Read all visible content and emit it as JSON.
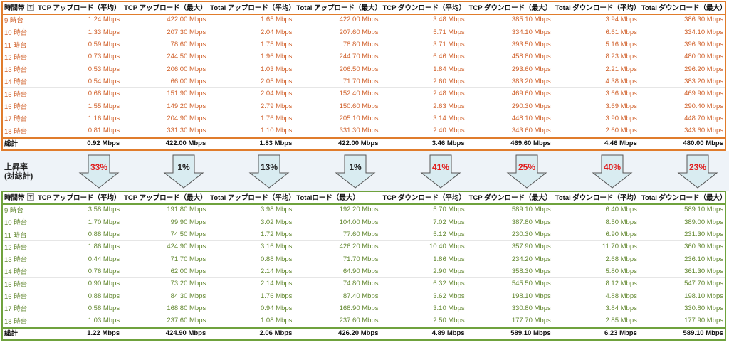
{
  "top_table": {
    "headers": [
      "時間帯",
      "TCP アップロード（平均）",
      "TCP アップロード（最大）",
      "Total アップロード（平均）",
      "Total アップロード（最大）",
      "TCP ダウンロード（平均）",
      "TCP ダウンロード（最大）",
      "Total ダウンロード（平均）",
      "Total ダウンロード（最大）"
    ],
    "rows": [
      [
        "9 時台",
        "1.24 Mbps",
        "422.00 Mbps",
        "1.65 Mbps",
        "422.00 Mbps",
        "3.48 Mbps",
        "385.10 Mbps",
        "3.94 Mbps",
        "386.30 Mbps"
      ],
      [
        "10 時台",
        "1.33 Mbps",
        "207.30 Mbps",
        "2.04 Mbps",
        "207.60 Mbps",
        "5.71 Mbps",
        "334.10 Mbps",
        "6.61 Mbps",
        "334.10 Mbps"
      ],
      [
        "11 時台",
        "0.59 Mbps",
        "78.60 Mbps",
        "1.75 Mbps",
        "78.80 Mbps",
        "3.71 Mbps",
        "393.50 Mbps",
        "5.16 Mbps",
        "396.30 Mbps"
      ],
      [
        "12 時台",
        "0.73 Mbps",
        "244.50 Mbps",
        "1.96 Mbps",
        "244.70 Mbps",
        "6.46 Mbps",
        "458.80 Mbps",
        "8.23 Mbps",
        "480.00 Mbps"
      ],
      [
        "13 時台",
        "0.53 Mbps",
        "206.00 Mbps",
        "1.03 Mbps",
        "206.50 Mbps",
        "1.84 Mbps",
        "293.60 Mbps",
        "2.21 Mbps",
        "296.20 Mbps"
      ],
      [
        "14 時台",
        "0.54 Mbps",
        "66.00 Mbps",
        "2.05 Mbps",
        "71.70 Mbps",
        "2.60 Mbps",
        "383.20 Mbps",
        "4.38 Mbps",
        "383.20 Mbps"
      ],
      [
        "15 時台",
        "0.68 Mbps",
        "151.90 Mbps",
        "2.04 Mbps",
        "152.40 Mbps",
        "2.48 Mbps",
        "469.60 Mbps",
        "3.66 Mbps",
        "469.90 Mbps"
      ],
      [
        "16 時台",
        "1.55 Mbps",
        "149.20 Mbps",
        "2.79 Mbps",
        "150.60 Mbps",
        "2.63 Mbps",
        "290.30 Mbps",
        "3.69 Mbps",
        "290.40 Mbps"
      ],
      [
        "17 時台",
        "1.16 Mbps",
        "204.90 Mbps",
        "1.76 Mbps",
        "205.10 Mbps",
        "3.14 Mbps",
        "448.10 Mbps",
        "3.90 Mbps",
        "448.70 Mbps"
      ],
      [
        "18 時台",
        "0.81 Mbps",
        "331.30 Mbps",
        "1.10 Mbps",
        "331.30 Mbps",
        "2.40 Mbps",
        "343.60 Mbps",
        "2.60 Mbps",
        "343.60 Mbps"
      ]
    ],
    "total": [
      "総計",
      "0.92 Mbps",
      "422.00 Mbps",
      "1.83 Mbps",
      "422.00 Mbps",
      "3.46 Mbps",
      "469.60 Mbps",
      "4.46 Mbps",
      "480.00 Mbps"
    ]
  },
  "rise": {
    "label_line1": "上昇率",
    "label_line2": "(対総計)",
    "arrows": [
      {
        "text": "33%",
        "color": "red"
      },
      {
        "text": "1%",
        "color": "black"
      },
      {
        "text": "13%",
        "color": "black"
      },
      {
        "text": "1%",
        "color": "black"
      },
      {
        "text": "41%",
        "color": "red"
      },
      {
        "text": "25%",
        "color": "red"
      },
      {
        "text": "40%",
        "color": "red"
      },
      {
        "text": "23%",
        "color": "red"
      }
    ],
    "arrow_fill": "#d9ecf1",
    "arrow_stroke": "#555555"
  },
  "bottom_table": {
    "headers": [
      "時間帯",
      "TCP アップロード（平均）",
      "TCP アップロード（最大）",
      "Total アップロード（平均）",
      "Totalロード（最大）",
      "TCP ダウンロード（平均）",
      "TCP ダウンロード（最大）",
      "Total ダウンロード（平均）",
      "Total ダウンロード（最大）"
    ],
    "rows": [
      [
        "9 時台",
        "3.58 Mbps",
        "191.80 Mbps",
        "3.98 Mbps",
        "192.20 Mbps",
        "5.70 Mbps",
        "589.10 Mbps",
        "6.40 Mbps",
        "589.10 Mbps"
      ],
      [
        "10 時台",
        "1.70 Mbps",
        "99.90 Mbps",
        "3.02 Mbps",
        "104.00 Mbps",
        "7.02 Mbps",
        "387.80 Mbps",
        "8.50 Mbps",
        "389.00 Mbps"
      ],
      [
        "11 時台",
        "0.88 Mbps",
        "74.50 Mbps",
        "1.72 Mbps",
        "77.60 Mbps",
        "5.12 Mbps",
        "230.30 Mbps",
        "6.90 Mbps",
        "231.30 Mbps"
      ],
      [
        "12 時台",
        "1.86 Mbps",
        "424.90 Mbps",
        "3.16 Mbps",
        "426.20 Mbps",
        "10.40 Mbps",
        "357.90 Mbps",
        "11.70 Mbps",
        "360.30 Mbps"
      ],
      [
        "13 時台",
        "0.44 Mbps",
        "71.70 Mbps",
        "0.88 Mbps",
        "71.70 Mbps",
        "1.86 Mbps",
        "234.20 Mbps",
        "2.68 Mbps",
        "236.10 Mbps"
      ],
      [
        "14 時台",
        "0.76 Mbps",
        "62.00 Mbps",
        "2.14 Mbps",
        "64.90 Mbps",
        "2.90 Mbps",
        "358.30 Mbps",
        "5.80 Mbps",
        "361.30 Mbps"
      ],
      [
        "15 時台",
        "0.90 Mbps",
        "73.20 Mbps",
        "2.14 Mbps",
        "74.80 Mbps",
        "6.32 Mbps",
        "545.50 Mbps",
        "8.12 Mbps",
        "547.70 Mbps"
      ],
      [
        "16 時台",
        "0.88 Mbps",
        "84.30 Mbps",
        "1.76 Mbps",
        "87.40 Mbps",
        "3.62 Mbps",
        "198.10 Mbps",
        "4.88 Mbps",
        "198.10 Mbps"
      ],
      [
        "17 時台",
        "0.58 Mbps",
        "168.80 Mbps",
        "0.94 Mbps",
        "168.90 Mbps",
        "3.10 Mbps",
        "330.80 Mbps",
        "3.84 Mbps",
        "330.80 Mbps"
      ],
      [
        "18 時台",
        "1.03 Mbps",
        "237.60 Mbps",
        "1.08 Mbps",
        "237.60 Mbps",
        "2.50 Mbps",
        "177.70 Mbps",
        "2.85 Mbps",
        "177.90 Mbps"
      ]
    ],
    "total": [
      "総計",
      "1.22 Mbps",
      "424.90 Mbps",
      "2.06 Mbps",
      "426.20 Mbps",
      "4.89 Mbps",
      "589.10 Mbps",
      "6.23 Mbps",
      "589.10 Mbps"
    ]
  },
  "colors": {
    "top_values": "#d0602a",
    "top_frame": "#e07c2c",
    "bottom_values": "#62872f",
    "bottom_frame": "#6fa23d",
    "percent_red": "#e01e1e"
  }
}
